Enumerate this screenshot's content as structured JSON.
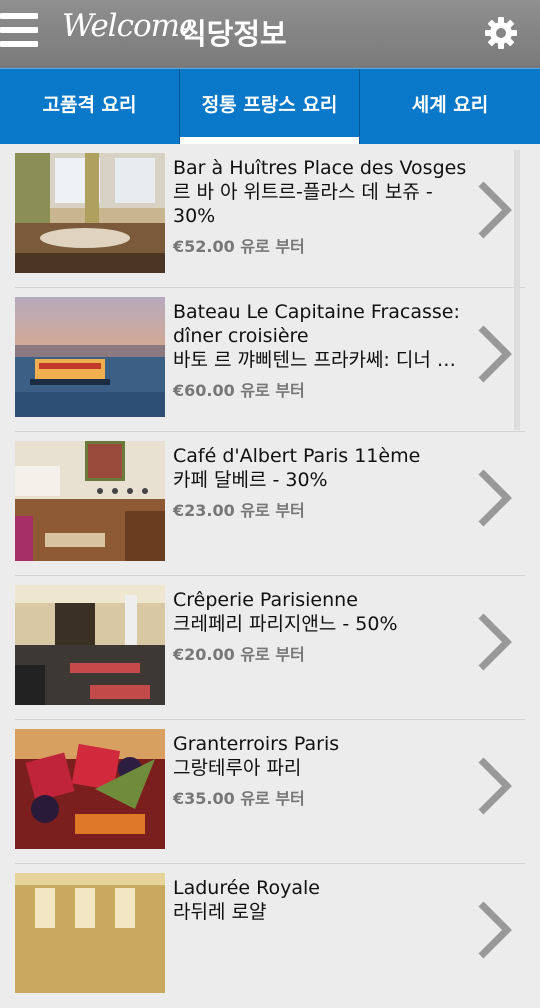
{
  "header": {
    "welcome": "Welcome",
    "title": "식당정보"
  },
  "tabs": [
    {
      "label": "고품격 요리"
    },
    {
      "label": "정통 프랑스 요리"
    },
    {
      "label": "세계 요리"
    }
  ],
  "restaurants": [
    {
      "name1": "Bar à Huîtres Place des Vosges",
      "name2": "르 바 아 위트르-플라스 데 보쥬 -",
      "name3": "30%",
      "price": "€52.00 유로 부터"
    },
    {
      "name1": "Bateau Le Capitaine Fracasse:",
      "name2": "dîner croisière",
      "name3": "바토 르 꺄삐텐느 프라카쎄: 디너 크루즈",
      "price": "€60.00 유로 부터"
    },
    {
      "name1": "Café d'Albert Paris 11ème",
      "name2": "카페 달베르 - 30%",
      "price": "€23.00 유로 부터"
    },
    {
      "name1": "Crêperie Parisienne",
      "name2": "크레페리 파리지앤느 - 50%",
      "price": "€20.00 유로 부터"
    },
    {
      "name1": "Granterroirs Paris",
      "name2": "그랑테루아 파리",
      "price": "€35.00 유로 부터"
    },
    {
      "name1": "Ladurée Royale",
      "name2": "라뒤레 로얄"
    }
  ]
}
